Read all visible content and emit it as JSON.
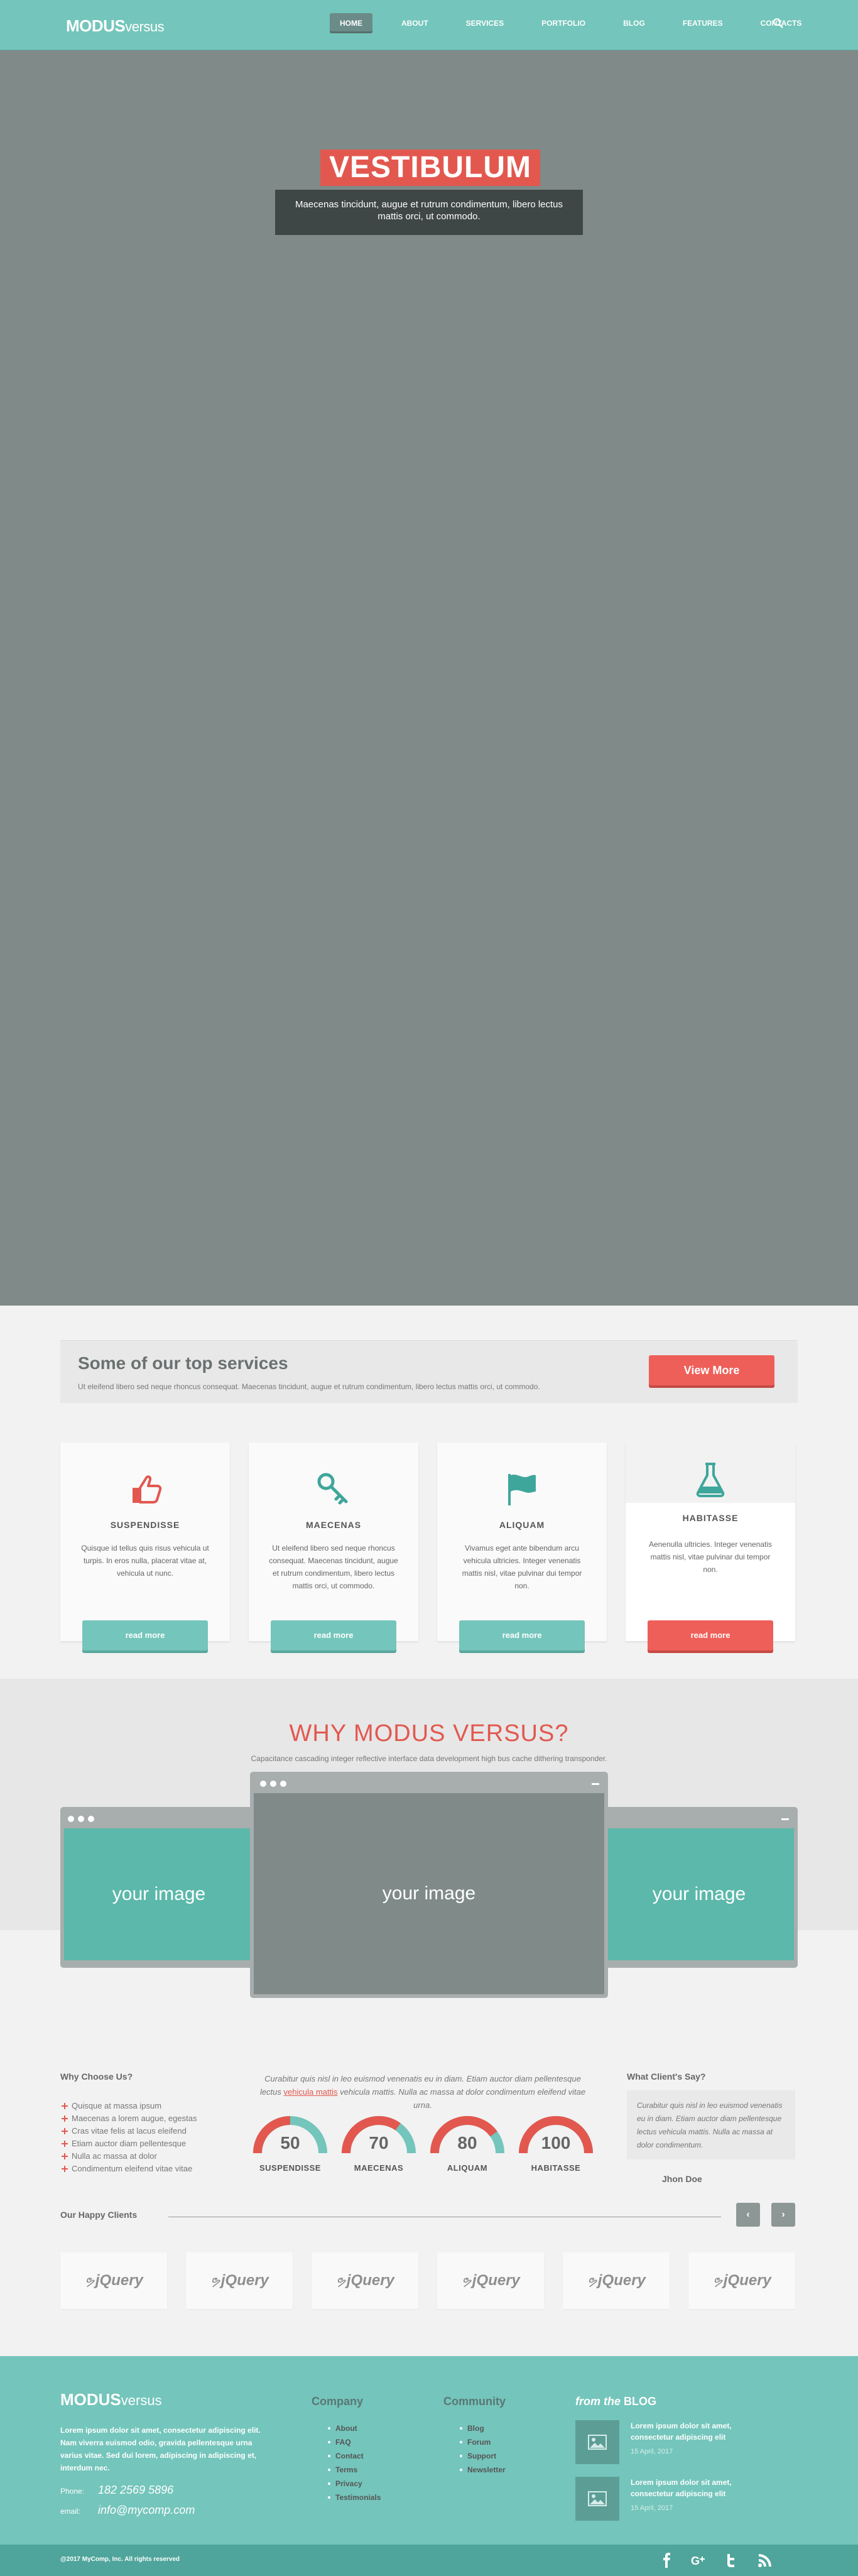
{
  "header": {
    "logo_bold": "MODUS",
    "logo_thin": "versus",
    "nav": [
      "HOME",
      "ABOUT",
      "SERVICES",
      "PORTFOLIO",
      "BLOG",
      "FEATURES",
      "CONTACTS"
    ],
    "active": "HOME"
  },
  "hero": {
    "title": "VESTIBULUM",
    "caption": "Maecenas tincidunt, augue et rutrum condimentum, libero lectus mattis orci, ut commodo."
  },
  "services_bar": {
    "title": "Some of our top services",
    "subtitle": "Ut eleifend libero sed neque rhoncus consequat. Maecenas tincidunt, augue et rutrum condimentum, libero lectus mattis orci, ut commodo.",
    "button": "View More"
  },
  "cards": [
    {
      "icon": "thumbs-up-icon",
      "title": "SUSPENDISSE",
      "text": "Quisque id tellus quis risus vehicula ut turpis. In eros nulla, placerat vitae at, vehicula ut nunc.",
      "button": "read more"
    },
    {
      "icon": "key-icon",
      "title": "MAECENAS",
      "text": "Ut eleifend libero sed neque rhoncus consequat. Maecenas tincidunt, augue et rutrum condimentum, libero lectus mattis orci, ut commodo.",
      "button": "read more"
    },
    {
      "icon": "flag-icon",
      "title": "ALIQUAM",
      "text": "Vivamus eget ante bibendum arcu vehicula ultricies. Integer venenatis mattis nisl, vitae pulvinar dui tempor non.",
      "button": "read more"
    },
    {
      "icon": "flask-icon",
      "title": "HABITASSE",
      "text": "Aenenulla ultricies. Integer venenatis mattis nisl, vitae pulvinar dui tempor non.",
      "button": "read more"
    }
  ],
  "why": {
    "title": "WHY MODUS VERSUS?",
    "subtitle": "Capacitance cascading integer reflective interface data development high bus cache dithering transponder.",
    "images": [
      "your image",
      "your image",
      "your image"
    ]
  },
  "choose": {
    "title": "Why Choose Us?",
    "items": [
      "Quisque at massa ipsum",
      "Maecenas a lorem augue, egestas",
      "Cras vitae felis at lacus eleifend",
      "Etiam auctor diam pellentesque",
      "Nulla ac massa at dolor",
      "Condimentum eleifend vitae vitae"
    ]
  },
  "mid": {
    "text_before": "Curabitur quis nisl in leo euismod venenatis eu in diam. Etiam auctor diam pellentesque lectus",
    "link": "vehicula mattis",
    "text_after": "vehicula mattis. Nulla ac massa at dolor condimentum eleifend vitae urna."
  },
  "gauges": [
    {
      "value": 50,
      "label": "SUSPENDISSE",
      "percent": 0.5
    },
    {
      "value": 70,
      "label": "MAECENAS",
      "percent": 0.7
    },
    {
      "value": 80,
      "label": "ALIQUAM",
      "percent": 0.8
    },
    {
      "value": 100,
      "label": "HABITASSE",
      "percent": 1.0
    }
  ],
  "testimonial": {
    "title": "What Client's Say?",
    "text": "Curabitur quis nisl in leo euismod venenatis eu in diam. Etiam auctor diam pellentesque lectus vehicula mattis. Nulla ac massa at dolor condimentum.",
    "author": "Jhon Doe"
  },
  "clients": {
    "title": "Our Happy Clients",
    "prev": "‹",
    "next": "›",
    "logos": [
      "jQuery",
      "jQuery",
      "jQuery",
      "jQuery",
      "jQuery",
      "jQuery"
    ]
  },
  "footer": {
    "logo_bold": "MODUS",
    "logo_thin": "versus",
    "about": "Lorem ipsum dolor sit amet, consectetur adipiscing elit. Nam viverra euismod odio, gravida pellentesque urna varius vitae. Sed dui lorem, adipiscing in adipiscing et, interdum nec.",
    "phone_label": "Phone:",
    "phone": "182 2569 5896",
    "email_label": "email:",
    "email": "info@mycomp.com",
    "company_title": "Company",
    "company": [
      "About",
      "FAQ",
      "Contact",
      "Terms",
      "Privacy",
      "Testimonials"
    ],
    "community_title": "Community",
    "community": [
      "Blog",
      "Forum",
      "Support",
      "Newsletter"
    ],
    "blog_from": "from the ",
    "blog_word": "BLOG",
    "posts": [
      {
        "title": "Lorem ipsum dolor sit amet, consectetur adipiscing elit",
        "date": "15 April, 2017"
      },
      {
        "title": "Lorem ipsum dolor sit amet, consectetur adipiscing elit",
        "date": "15 April, 2017"
      }
    ],
    "copyright": "@2017 MyComp, Inc. All rights reserved",
    "social": [
      "facebook-icon",
      "google-plus-icon",
      "twitter-icon",
      "rss-icon"
    ]
  },
  "colors": {
    "teal": "#74c5bb",
    "red": "#e2584f",
    "gray": "#7f8a89"
  }
}
